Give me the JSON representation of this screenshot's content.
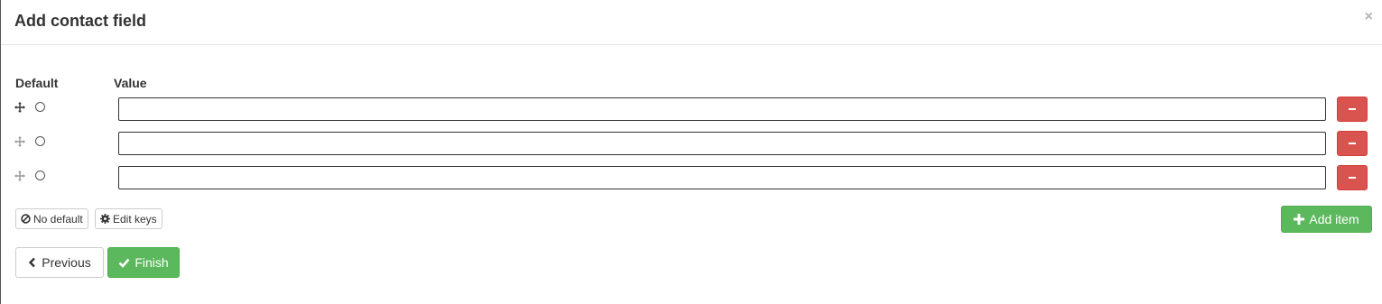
{
  "dialog": {
    "title": "Add contact field",
    "close_glyph": "×",
    "close_icon": "close-icon"
  },
  "columns": {
    "default": "Default",
    "value": "Value"
  },
  "rows": [
    {
      "value": "",
      "default_selected": false,
      "drag_icon": "move-icon",
      "remove_icon": "minus-icon"
    },
    {
      "value": "",
      "default_selected": false,
      "drag_icon": "move-icon",
      "remove_icon": "minus-icon"
    },
    {
      "value": "",
      "default_selected": false,
      "drag_icon": "move-icon",
      "remove_icon": "minus-icon"
    }
  ],
  "actions": {
    "no_default": "No default",
    "no_default_icon": "ban-icon",
    "edit_keys": "Edit keys",
    "edit_keys_icon": "gear-icon",
    "add_item": "Add item",
    "add_item_icon": "plus-icon"
  },
  "footer": {
    "previous": "Previous",
    "previous_icon": "chevron-left-icon",
    "finish": "Finish",
    "finish_icon": "check-icon"
  },
  "colors": {
    "danger": "#d9534f",
    "success": "#5cb85c",
    "text": "#333333"
  }
}
